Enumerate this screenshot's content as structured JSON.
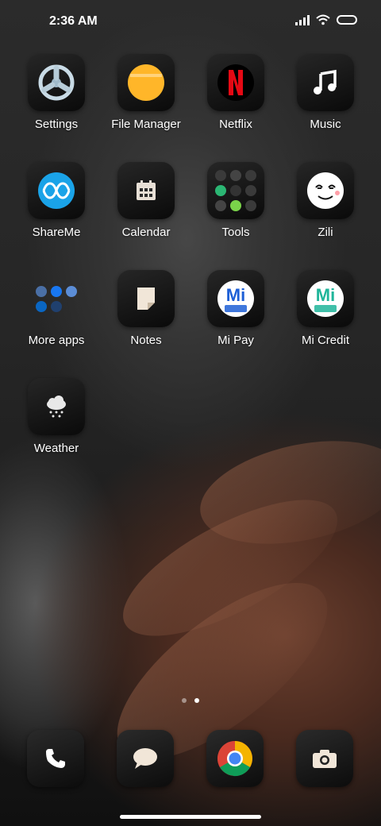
{
  "status_bar": {
    "time": "2:36 AM"
  },
  "apps": [
    {
      "label": "Settings",
      "icon": "settings-icon"
    },
    {
      "label": "File Manager",
      "icon": "file-manager-icon"
    },
    {
      "label": "Netflix",
      "icon": "netflix-icon",
      "glyph": "N"
    },
    {
      "label": "Music",
      "icon": "music-icon",
      "glyph": "♫"
    },
    {
      "label": "ShareMe",
      "icon": "shareme-icon"
    },
    {
      "label": "Calendar",
      "icon": "calendar-icon"
    },
    {
      "label": "Tools",
      "icon": "tools-folder-icon"
    },
    {
      "label": "Zili",
      "icon": "zili-icon"
    },
    {
      "label": "More apps",
      "icon": "more-apps-folder-icon"
    },
    {
      "label": "Notes",
      "icon": "notes-icon"
    },
    {
      "label": "Mi Pay",
      "icon": "mi-pay-icon",
      "glyph": "Mi"
    },
    {
      "label": "Mi Credit",
      "icon": "mi-credit-icon",
      "glyph": "Mi"
    },
    {
      "label": "Weather",
      "icon": "weather-icon"
    }
  ],
  "page_indicator": {
    "pages": 2,
    "current": 2
  },
  "dock": [
    {
      "icon": "phone-icon"
    },
    {
      "icon": "messages-icon"
    },
    {
      "icon": "chrome-icon"
    },
    {
      "icon": "camera-icon"
    }
  ],
  "colors": {
    "netflix_red": "#e50914",
    "file_manager_orange": "#ffb629",
    "shareme_blue": "#1aa3e8",
    "mi_green": "#1fb59a",
    "mi_pay_blue": "#1d5fd6"
  }
}
